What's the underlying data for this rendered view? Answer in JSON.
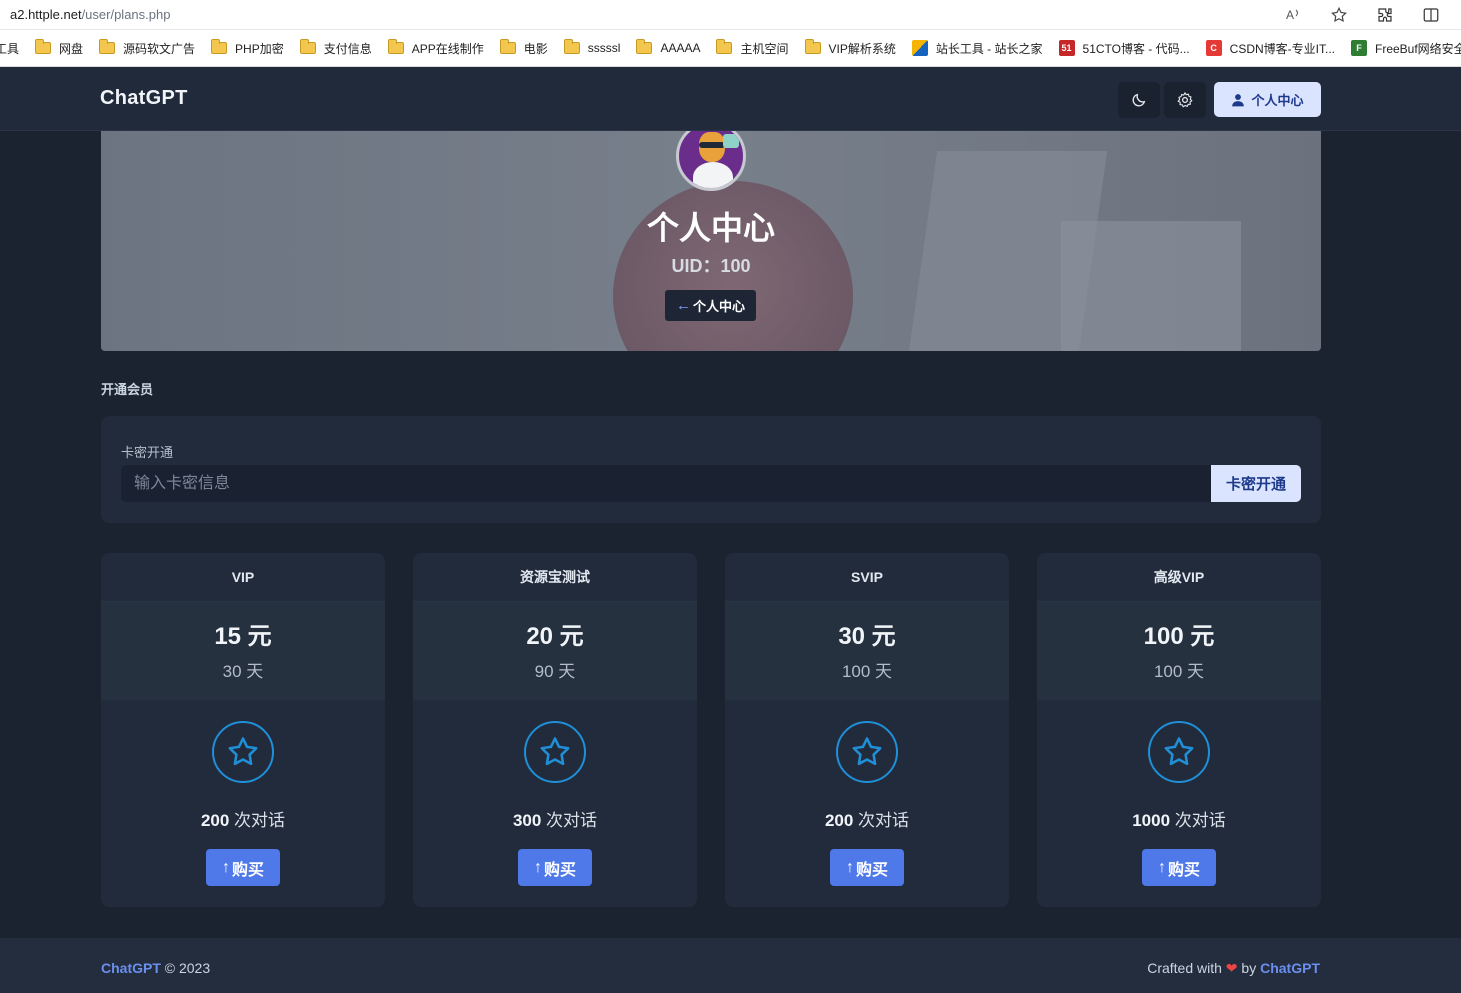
{
  "browser": {
    "url_host": "a2.httple.net",
    "url_path": "/user/plans.php",
    "bookmarks": [
      {
        "label": "工具",
        "icon": "folder-icon"
      },
      {
        "label": "网盘",
        "icon": "folder-icon"
      },
      {
        "label": "源码软文广告",
        "icon": "folder-icon"
      },
      {
        "label": "PHP加密",
        "icon": "folder-icon"
      },
      {
        "label": "支付信息",
        "icon": "folder-icon"
      },
      {
        "label": "APP在线制作",
        "icon": "folder-icon"
      },
      {
        "label": "电影",
        "icon": "folder-icon"
      },
      {
        "label": "sssssl",
        "icon": "folder-icon"
      },
      {
        "label": "AAAAA",
        "icon": "folder-icon"
      },
      {
        "label": "主机空间",
        "icon": "folder-icon"
      },
      {
        "label": "VIP解析系统",
        "icon": "folder-icon"
      },
      {
        "label": "站长工具 - 站长之家",
        "icon": "chinaz-icon"
      },
      {
        "label": "51CTO博客 - 代码...",
        "icon": "51cto-icon"
      },
      {
        "label": "CSDN博客-专业IT...",
        "icon": "csdn-icon"
      },
      {
        "label": "FreeBuf网络安全行...",
        "icon": "freebuf-icon"
      }
    ]
  },
  "nav": {
    "brand": "ChatGPT",
    "user_center": "个人中心"
  },
  "hero": {
    "title": "个人中心",
    "uid": "UID：100",
    "back_label": "个人中心"
  },
  "section": {
    "title": "开通会员",
    "card_label": "卡密开通",
    "card_placeholder": "输入卡密信息",
    "card_submit": "卡密开通"
  },
  "plans": [
    {
      "name": "VIP",
      "price": "15 元",
      "days": "30 天",
      "chats": "200",
      "chats_unit": " 次对话",
      "buy": "购买"
    },
    {
      "name": "资源宝测试",
      "price": "20 元",
      "days": "90 天",
      "chats": "300",
      "chats_unit": " 次对话",
      "buy": "购买"
    },
    {
      "name": "SVIP",
      "price": "30 元",
      "days": "100 天",
      "chats": "200",
      "chats_unit": " 次对话",
      "buy": "购买"
    },
    {
      "name": "高级VIP",
      "price": "100 元",
      "days": "100 天",
      "chats": "1000",
      "chats_unit": " 次对话",
      "buy": "购买"
    }
  ],
  "footer": {
    "brand": "ChatGPT",
    "copyright": "© 2023",
    "crafted": "Crafted with",
    "by": "by",
    "author": "ChatGPT"
  },
  "colors": {
    "accent": "#4f78e8",
    "star": "#1f8fd8",
    "background": "#1b2331"
  }
}
